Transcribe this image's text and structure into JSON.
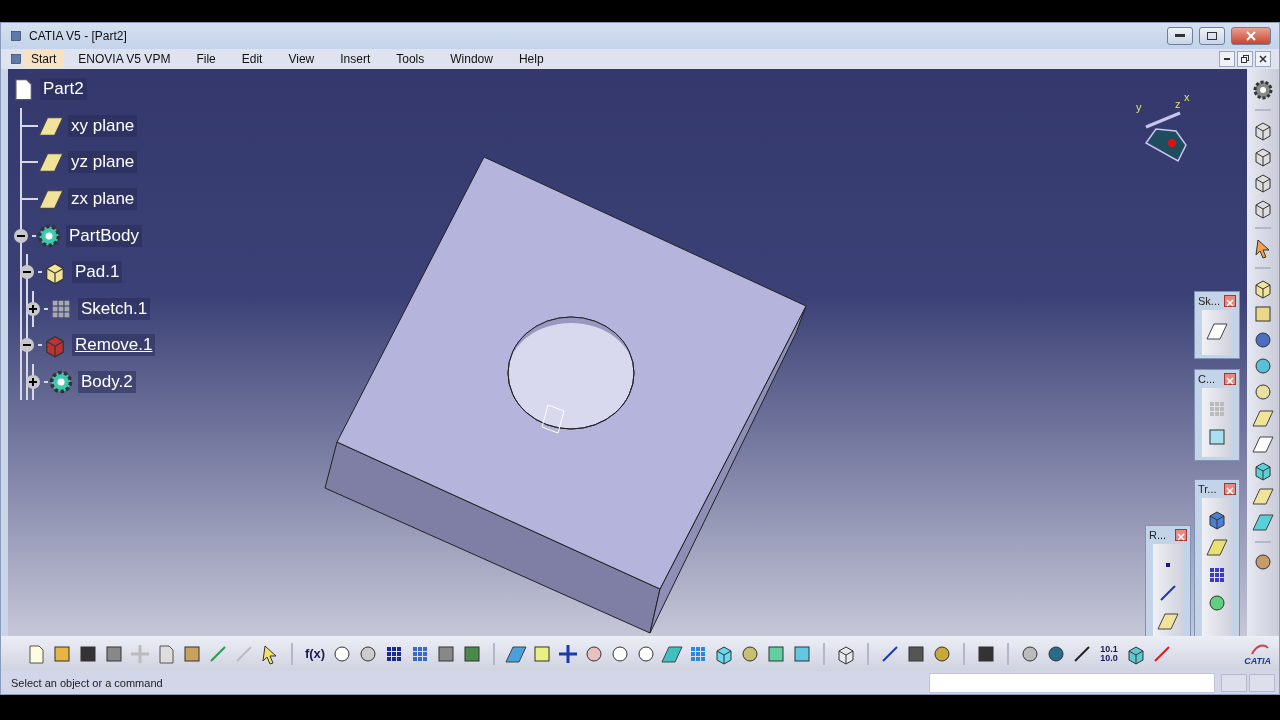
{
  "window": {
    "title": "CATIA V5 - [Part2]"
  },
  "menu": [
    {
      "label": "Start",
      "selected": true
    },
    {
      "label": "ENOVIA V5 VPM",
      "selected": false
    },
    {
      "label": "File",
      "selected": false
    },
    {
      "label": "Edit",
      "selected": false
    },
    {
      "label": "View",
      "selected": false
    },
    {
      "label": "Insert",
      "selected": false
    },
    {
      "label": "Tools",
      "selected": false
    },
    {
      "label": "Window",
      "selected": false
    },
    {
      "label": "Help",
      "selected": false
    }
  ],
  "tree": {
    "label": "Part2",
    "kind": "part",
    "children": [
      {
        "label": "xy plane",
        "kind": "plane"
      },
      {
        "label": "yz plane",
        "kind": "plane"
      },
      {
        "label": "zx plane",
        "kind": "plane"
      },
      {
        "label": "PartBody",
        "kind": "body",
        "expanded": true,
        "children": [
          {
            "label": "Pad.1",
            "kind": "pad",
            "expanded": true,
            "children": [
              {
                "label": "Sketch.1",
                "kind": "sketch",
                "expanded": false
              }
            ]
          },
          {
            "label": "Remove.1",
            "kind": "remove",
            "expanded": true,
            "current": true,
            "children": [
              {
                "label": "Body.2",
                "kind": "insertbody",
                "expanded": false
              }
            ]
          }
        ]
      }
    ]
  },
  "compass": {
    "axis_labels": [
      "y",
      "z",
      "x"
    ]
  },
  "floating_toolbars": [
    {
      "title": "Sk..."
    },
    {
      "title": "C..."
    },
    {
      "title": "Tr..."
    },
    {
      "title": "R..."
    }
  ],
  "bottom_toolbar": {
    "formula_glyph": "f(x)",
    "units_glyph": [
      "10.1",
      "10.0"
    ],
    "logo": "CATIA"
  },
  "status_bar": {
    "message": "Select an object or a command"
  }
}
